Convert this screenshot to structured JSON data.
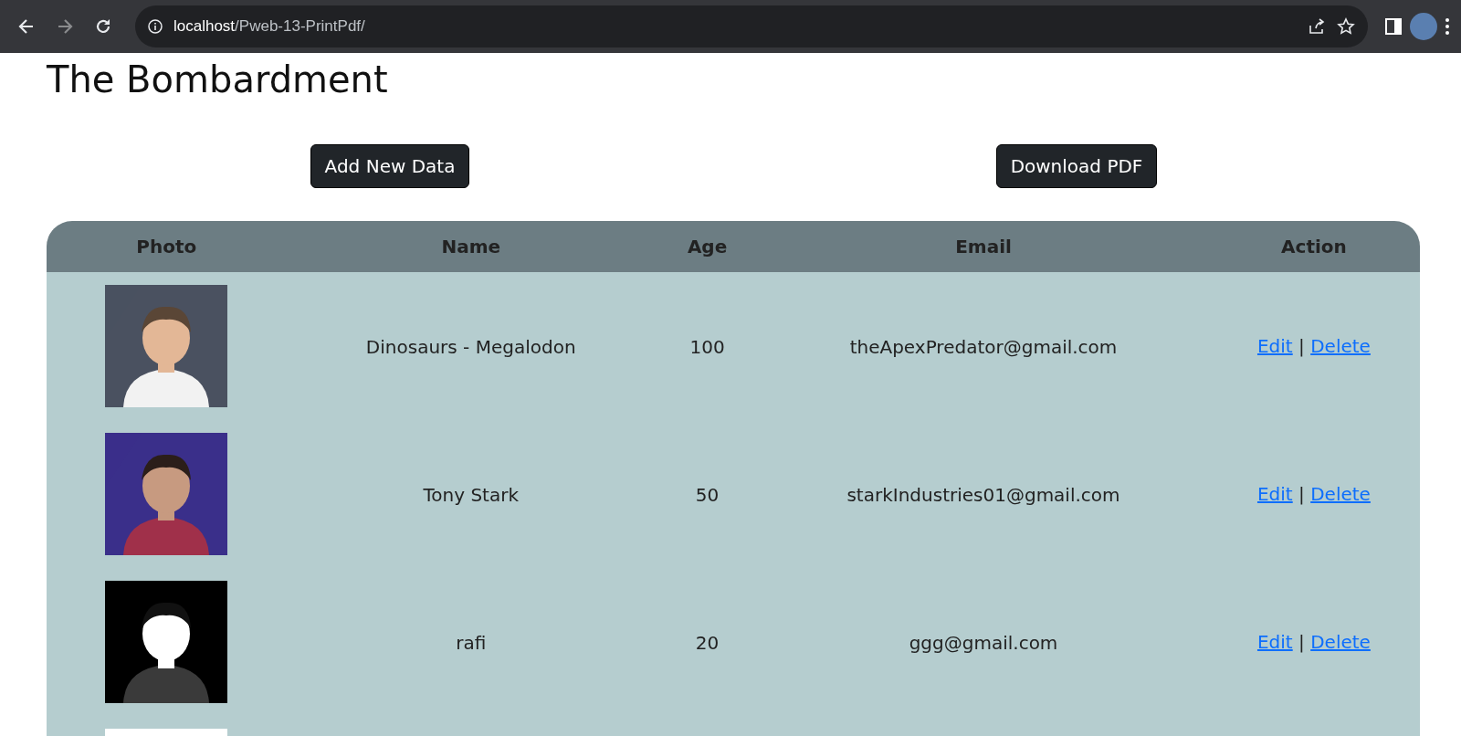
{
  "browser": {
    "url_host": "localhost",
    "url_path": "/Pweb-13-PrintPdf/"
  },
  "title": "The Bombardment",
  "buttons": [
    "Add New Data",
    "Download PDF"
  ],
  "table": {
    "columns": [
      "Photo",
      "Name",
      "Age",
      "Email",
      "Action"
    ],
    "rows": [
      {
        "photo": {
          "kind": "picture"
        },
        "name": "Dinosaurs - Megalodon",
        "age": "100",
        "email": "theApexPredator@gmail.com",
        "actions": [
          "Edit",
          "Delete"
        ],
        "separator": "|"
      },
      {
        "photo": {
          "kind": "picture"
        },
        "name": "Tony Stark",
        "age": "50",
        "email": "starkIndustries01@gmail.com",
        "actions": [
          "Edit",
          "Delete"
        ],
        "separator": "|"
      },
      {
        "photo": {
          "kind": "picture"
        },
        "name": "rafi",
        "age": "20",
        "email": "ggg@gmail.com",
        "actions": [
          "Edit",
          "Delete"
        ],
        "separator": "|"
      },
      {
        "photo": {
          "kind": "picture"
        }
      }
    ]
  }
}
